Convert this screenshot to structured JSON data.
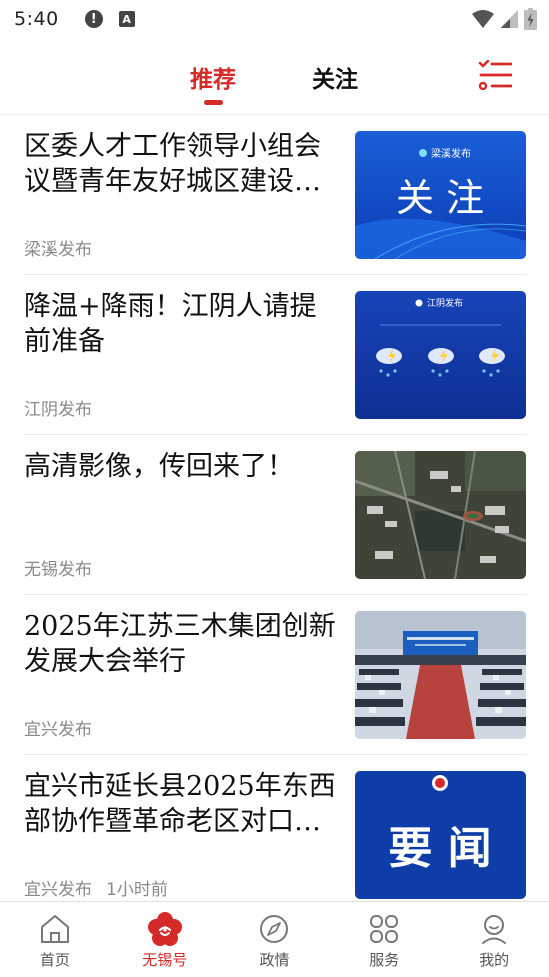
{
  "status_bar": {
    "time": "5:40",
    "alert_glyph": "!",
    "a_glyph": "A"
  },
  "tabs": [
    {
      "label": "推荐",
      "active": true
    },
    {
      "label": "关注",
      "active": false
    }
  ],
  "thumb_text": {
    "t1_brand": "梁溪发布",
    "t1_main": "关 注",
    "t2_brand": "江阴发布",
    "t5_main": "要 闻"
  },
  "feed": [
    {
      "title": "区委人才工作领导小组会议暨青年友好城区建设…",
      "source": "梁溪发布",
      "time": ""
    },
    {
      "title": "降温+降雨！江阴人请提前准备",
      "source": "江阴发布",
      "time": ""
    },
    {
      "title": "高清影像，传回来了！",
      "source": "无锡发布",
      "time": ""
    },
    {
      "title": "2025年江苏三木集团创新发展大会举行",
      "source": "宜兴发布",
      "time": ""
    },
    {
      "title": "宜兴市延长县2025年东西部协作暨革命老区对口…",
      "source": "宜兴发布",
      "time": "1小时前"
    }
  ],
  "bottom_nav": [
    {
      "label": "首页",
      "icon": "home-icon"
    },
    {
      "label": "无锡号",
      "icon": "plum-blossom-icon",
      "active": true
    },
    {
      "label": "政情",
      "icon": "compass-icon"
    },
    {
      "label": "服务",
      "icon": "services-grid-icon"
    },
    {
      "label": "我的",
      "icon": "profile-icon"
    }
  ],
  "colors": {
    "accent": "#d42a2a",
    "text": "#111111",
    "muted": "#8a8a8a"
  }
}
